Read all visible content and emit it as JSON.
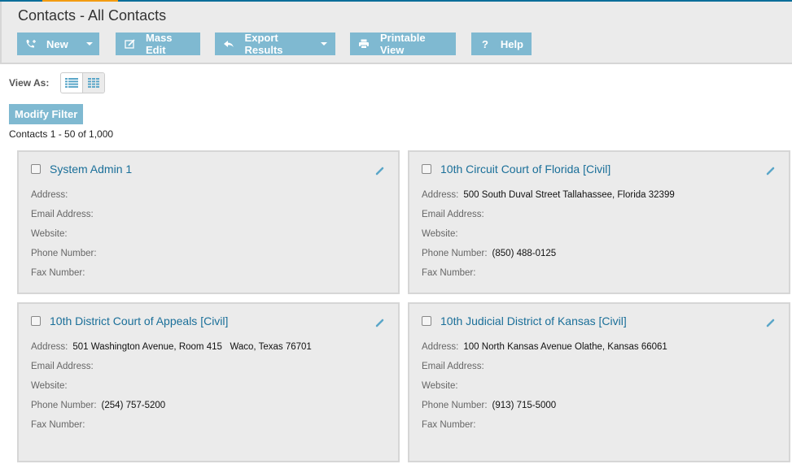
{
  "header": {
    "title": "Contacts - All Contacts",
    "toolbar": [
      {
        "id": "new",
        "label": "New",
        "icon": "phone-plus-icon",
        "dropdown": true
      },
      {
        "id": "mass-edit",
        "label": "Mass Edit",
        "icon": "edit-icon",
        "dropdown": false
      },
      {
        "id": "export-results",
        "label": "Export Results",
        "icon": "reply-icon",
        "dropdown": true
      },
      {
        "id": "printable-view",
        "label": "Printable View",
        "icon": "print-icon",
        "dropdown": false
      },
      {
        "id": "help",
        "label": "Help",
        "icon": "question-icon",
        "dropdown": false
      }
    ]
  },
  "view": {
    "label": "View As:",
    "modes": [
      "list",
      "grid"
    ],
    "selected": "grid"
  },
  "filter": {
    "modify_label": "Modify Filter"
  },
  "results": {
    "count_text": "Contacts 1 - 50 of 1,000"
  },
  "field_labels": {
    "address": "Address:",
    "email": "Email Address:",
    "website": "Website:",
    "phone": "Phone Number:",
    "fax": "Fax Number:"
  },
  "contacts": [
    {
      "name": "System Admin 1",
      "address": "",
      "email": "",
      "website": "",
      "phone": "",
      "fax": ""
    },
    {
      "name": "10th Circuit Court of Florida [Civil]",
      "address": "500 South Duval Street Tallahassee, Florida 32399",
      "email": "",
      "website": "",
      "phone": "(850) 488-0125",
      "fax": ""
    },
    {
      "name": "10th District Court of Appeals [Civil]",
      "address": "501 Washington Avenue, Room 415   Waco, Texas 76701",
      "email": "",
      "website": "",
      "phone": "(254) 757-5200",
      "fax": ""
    },
    {
      "name": "10th Judicial District of Kansas [Civil]",
      "address": "100 North Kansas Avenue Olathe, Kansas 66061",
      "email": "",
      "website": "",
      "phone": "(913) 715-5000",
      "fax": ""
    }
  ],
  "colors": {
    "accent": "#7fb9d1",
    "link": "#1a6f99",
    "top_bar": "#0a6e9a",
    "top_bar_highlight": "#f39c12"
  }
}
